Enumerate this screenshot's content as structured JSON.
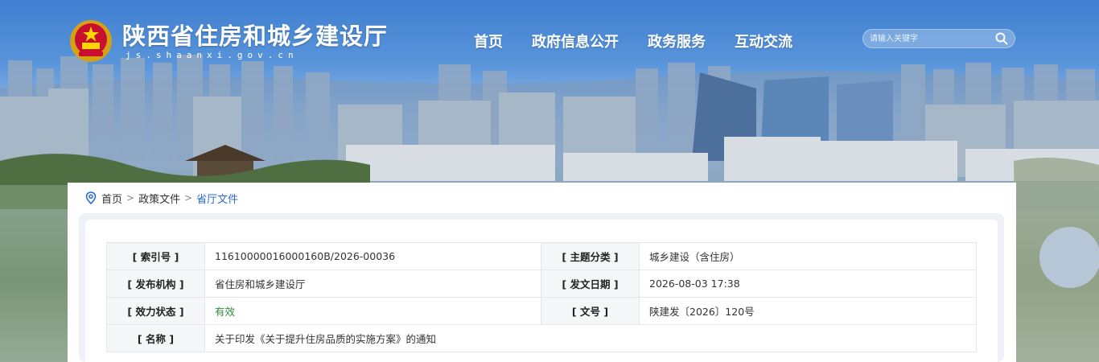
{
  "header": {
    "site_title": "陕西省住房和城乡建设厅",
    "site_domain": "js.shaanxi.gov.cn"
  },
  "nav": {
    "items": [
      {
        "label": "首页"
      },
      {
        "label": "政府信息公开"
      },
      {
        "label": "政务服务"
      },
      {
        "label": "互动交流"
      }
    ]
  },
  "search": {
    "placeholder": "请输入关键字",
    "icon": "search-icon"
  },
  "breadcrumb": {
    "icon": "location-pin-icon",
    "items": [
      "首页",
      "政策文件",
      "省厅文件"
    ],
    "separator": ">"
  },
  "doc_meta": {
    "rows": [
      {
        "k1": "[ 索引号 ]",
        "v1": "11610000016000160B/2026-00036",
        "k2": "[ 主题分类 ]",
        "v2": "城乡建设（含住房）"
      },
      {
        "k1": "[ 发布机构 ]",
        "v1": "省住房和城乡建设厅",
        "k2": "[ 发文日期 ]",
        "v2": "2026-08-03 17:38"
      },
      {
        "k1": "[ 效力状态 ]",
        "v1": "有效",
        "k2": "[ 文号 ]",
        "v2": "陕建发〔2026〕120号"
      },
      {
        "k1": "[ 名称 ]",
        "v1": "关于印发《关于提升住房品质的实施方案》的通知"
      }
    ]
  },
  "colors": {
    "accent": "#2b6bd1",
    "valid_status": "#2e8b3a",
    "label_bg": "#f5f6f8"
  }
}
